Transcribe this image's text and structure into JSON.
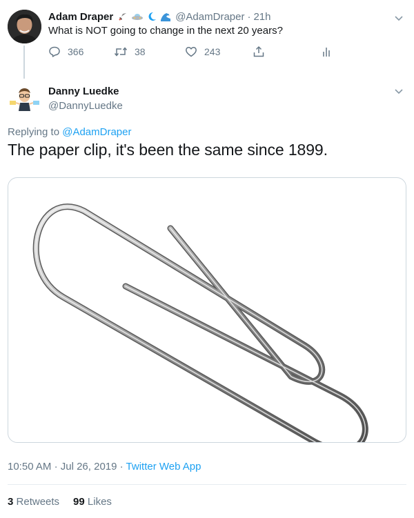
{
  "parent_tweet": {
    "display_name": "Adam Draper",
    "emoji_icons": [
      "rocket-icon",
      "ufo-icon",
      "moon-icon",
      "wave-icon"
    ],
    "handle": "@AdamDraper",
    "separator": "·",
    "time": "21h",
    "text": "What is NOT going to change in the next 20 years?",
    "actions": {
      "reply_count": "366",
      "retweet_count": "38",
      "like_count": "243"
    }
  },
  "reply_tweet": {
    "display_name": "Danny Luedke",
    "handle": "@DannyLuedke",
    "replying_prefix": "Replying to",
    "replying_handle": "@AdamDraper",
    "text": "The paper clip, it's been the same since 1899.",
    "media_icon": "paper-clip-image",
    "meta": {
      "time": "10:50 AM",
      "separator": "·",
      "date": "Jul 26, 2019",
      "source": "Twitter Web App"
    },
    "stats": {
      "retweets_count": "3",
      "retweets_label": "Retweets",
      "likes_count": "99",
      "likes_label": "Likes"
    }
  },
  "colors": {
    "link_blue": "#1da1f2",
    "secondary_text": "#657786",
    "primary_text": "#14171a",
    "border": "#ccd6dd"
  }
}
